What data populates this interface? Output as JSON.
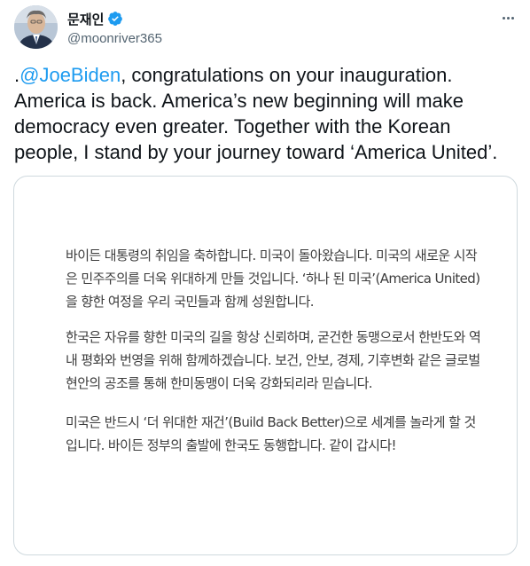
{
  "header": {
    "display_name": "문재인",
    "handle": "@moonriver365",
    "icons": {
      "verified": "verified-badge-icon",
      "more": "more-options-icon",
      "avatar": "profile-photo"
    }
  },
  "tweet": {
    "prefix": ".",
    "mention": "@JoeBiden",
    "text": ", congratulations on your inauguration. America is back. America’s new beginning will make democracy even greater. Together with the Korean people, I stand by your journey toward ‘America United’."
  },
  "media": {
    "paragraph_1": "바이든 대통령의 취임을 축하합니다. 미국이 돌아왔습니다. 미국의 새로운 시작은 민주주의를 더욱 위대하게 만들 것입니다. ‘하나 된 미국’(America United)을 향한 여정을 우리 국민들과 함께 성원합니다.",
    "paragraph_2": "한국은 자유를 향한 미국의 길을 항상 신뢰하며, 굳건한 동맹으로서 한반도와 역내 평화와 번영을 위해 함께하겠습니다. 보건, 안보, 경제, 기후변화 같은 글로벌 현안의 공조를 통해 한미동맹이 더욱 강화되리라 믿습니다.",
    "paragraph_3": "미국은 반드시 ‘더 위대한 재건’(Build Back Better)으로 세계를 놀라게 할 것입니다. 바이든 정부의 출발에 한국도 동행합니다. 같이 갑시다!"
  },
  "colors": {
    "accent": "#1d9bf0",
    "text": "#0f1419",
    "secondary": "#536471",
    "border": "#cfd9de"
  }
}
